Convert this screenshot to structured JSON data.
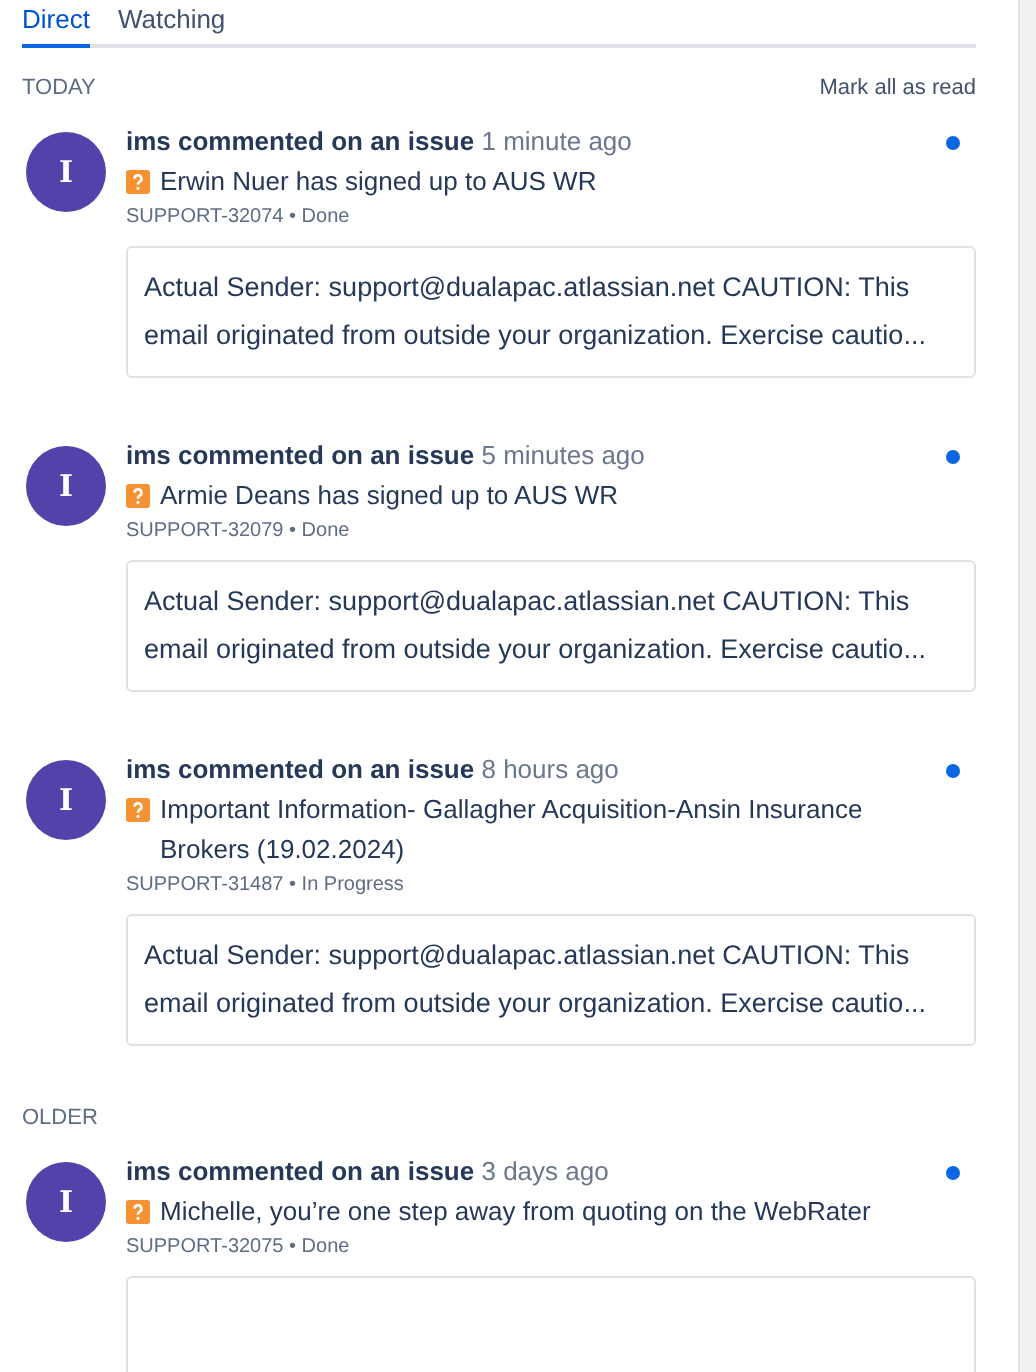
{
  "tabs": [
    {
      "label": "Direct",
      "selected": true
    },
    {
      "label": "Watching",
      "selected": false
    }
  ],
  "sections": [
    {
      "heading": "TODAY",
      "action": "Mark all as read",
      "items": [
        {
          "avatar": "I",
          "actor": "ims commented on an issue",
          "time": "1 minute ago",
          "unread": true,
          "issue_title": "Erwin Nuer has signed up to AUS WR",
          "meta": "SUPPORT-32074 • Done",
          "preview": "Actual Sender: support@dualapac.atlassian.net CAUTION: This email originated from outside your organization. Exercise cautio..."
        },
        {
          "avatar": "I",
          "actor": "ims commented on an issue",
          "time": "5 minutes ago",
          "unread": true,
          "issue_title": "Armie Deans has signed up to AUS WR",
          "meta": "SUPPORT-32079 • Done",
          "preview": "Actual Sender: support@dualapac.atlassian.net CAUTION: This email originated from outside your organization. Exercise cautio..."
        },
        {
          "avatar": "I",
          "actor": "ims commented on an issue",
          "time": "8 hours ago",
          "unread": true,
          "issue_title": "Important Information- Gallagher Acquisition-Ansin Insurance Brokers (19.02.2024)",
          "meta": "SUPPORT-31487 • In Progress",
          "preview": "Actual Sender: support@dualapac.atlassian.net CAUTION: This email originated from outside your organization. Exercise cautio..."
        }
      ]
    },
    {
      "heading": "OLDER",
      "items": [
        {
          "avatar": "I",
          "actor": "ims commented on an issue",
          "time": "3 days ago",
          "unread": true,
          "issue_title": "Michelle, you’re one step away from quoting on the WebRater",
          "meta": "SUPPORT-32075 • Done"
        }
      ]
    }
  ]
}
